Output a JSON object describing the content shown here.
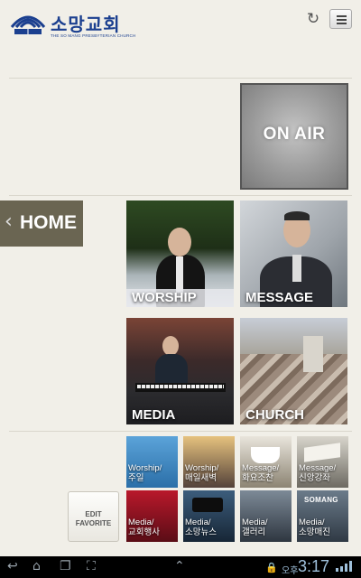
{
  "header": {
    "logo_text": "소망교회",
    "logo_sub": "THE SO MANG PRESBYTERIAN CHURCH",
    "brand_color": "#1b3f8f",
    "refresh_icon": "refresh-icon",
    "menu_icon": "menu-icon"
  },
  "onair": {
    "label": "ON AIR"
  },
  "home_tab": {
    "label": "HOME"
  },
  "main_tiles": [
    {
      "label": "WORSHIP"
    },
    {
      "label": "MESSAGE"
    },
    {
      "label": "MEDIA"
    },
    {
      "label": "CHURCH"
    }
  ],
  "favorites": [
    {
      "label": "Worship/\n주일"
    },
    {
      "label": "Worship/\n매일새벽"
    },
    {
      "label": "Message/\n화요조찬"
    },
    {
      "label": "Message/\n신앙강좌"
    },
    {
      "label": "Media/\n교회행사"
    },
    {
      "label": "Media/\n소망뉴스"
    },
    {
      "label": "Media/\n갤러리"
    },
    {
      "label": "Media/\n소망매진"
    }
  ],
  "somang_badge": "SOMANG",
  "edit_favorite": {
    "line1": "EDIT",
    "line2": "FAVORITE"
  },
  "system_bar": {
    "ampm": "오후",
    "time": "3:17"
  }
}
